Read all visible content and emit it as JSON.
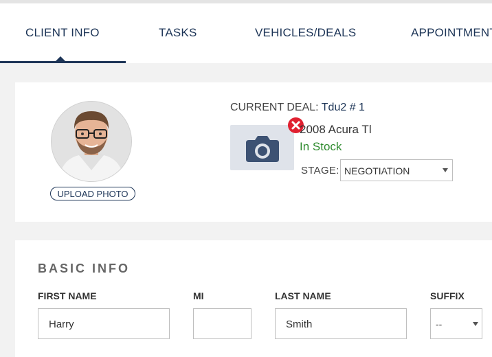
{
  "tabs": [
    {
      "label": "CLIENT INFO",
      "active": true
    },
    {
      "label": "TASKS"
    },
    {
      "label": "VEHICLES/DEALS"
    },
    {
      "label": "APPOINTMENTS"
    }
  ],
  "profile": {
    "upload_label": "UPLOAD PHOTO"
  },
  "deal": {
    "prefix": "CURRENT DEAL:",
    "name": "Tdu2 # 1",
    "vehicle": "2008 Acura Tl",
    "status": "In Stock",
    "stage_label": "STAGE:",
    "stage_value": "NEGOTIATION"
  },
  "basic_info": {
    "title": "BASIC INFO",
    "first_name_label": "FIRST NAME",
    "first_name_value": "Harry",
    "mi_label": "MI",
    "mi_value": "",
    "last_name_label": "LAST NAME",
    "last_name_value": "Smith",
    "suffix_label": "SUFFIX",
    "suffix_value": "--"
  },
  "colors": {
    "accent": "#1d3557",
    "status_in_stock": "#2e8b2e",
    "remove_red": "#e02030"
  },
  "icons": [
    "camera-icon",
    "remove-icon",
    "chevron-down-icon"
  ]
}
